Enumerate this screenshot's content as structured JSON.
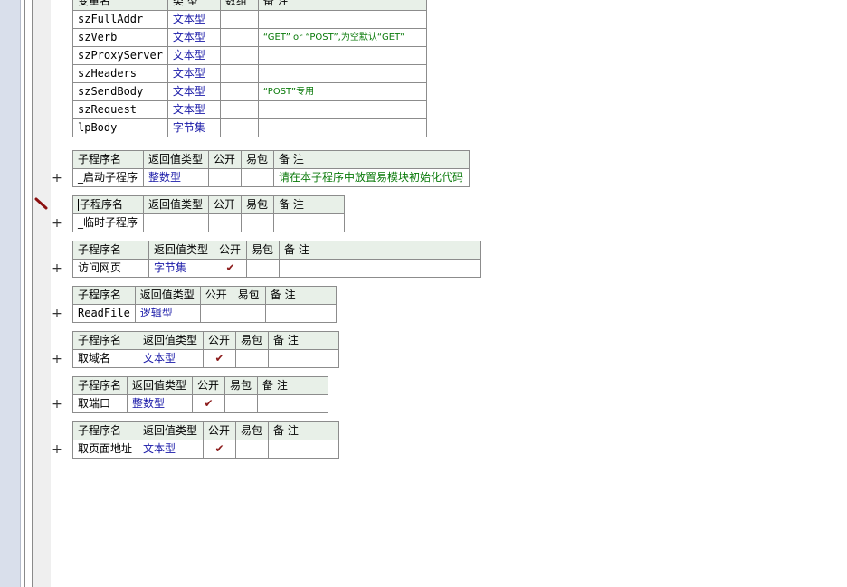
{
  "variables_table": {
    "headers": [
      "变量名",
      "类 型",
      "数组",
      "备 注"
    ],
    "rows": [
      {
        "name": "szFullAddr",
        "type": "文本型",
        "array": "",
        "remark": ""
      },
      {
        "name": "szVerb",
        "type": "文本型",
        "array": "",
        "remark": "“GET” or “POST”,为空默认“GET”"
      },
      {
        "name": "szProxyServer",
        "type": "文本型",
        "array": "",
        "remark": ""
      },
      {
        "name": "szHeaders",
        "type": "文本型",
        "array": "",
        "remark": ""
      },
      {
        "name": "szSendBody",
        "type": "文本型",
        "array": "",
        "remark": "“POST”专用"
      },
      {
        "name": "szRequest",
        "type": "文本型",
        "array": "",
        "remark": ""
      },
      {
        "name": "lpBody",
        "type": "字节集",
        "array": "",
        "remark": ""
      }
    ]
  },
  "sub_headers": {
    "name": "子程序名",
    "return_type": "返回值类型",
    "public": "公开",
    "easy": "易包",
    "remark": "备 注"
  },
  "subroutines": [
    {
      "name": "_启动子程序",
      "return_type": "整数型",
      "public": "",
      "easy": "",
      "remark": "请在本子程序中放置易模块初始化代码"
    },
    {
      "name": "_临时子程序",
      "return_type": "",
      "public": "",
      "easy": "",
      "remark": ""
    },
    {
      "name": "访问网页",
      "return_type": "字节集",
      "public": "✔",
      "easy": "",
      "remark": ""
    },
    {
      "name": "ReadFile",
      "return_type": "逻辑型",
      "public": "",
      "easy": "",
      "remark": ""
    },
    {
      "name": "取域名",
      "return_type": "文本型",
      "public": "✔",
      "easy": "",
      "remark": ""
    },
    {
      "name": "取端口",
      "return_type": "整数型",
      "public": "✔",
      "easy": "",
      "remark": ""
    },
    {
      "name": "取页面地址",
      "return_type": "文本型",
      "public": "✔",
      "easy": "",
      "remark": ""
    }
  ],
  "expand_glyph": "+",
  "icons": {
    "breakpoint_marker": "pencil-marker-icon",
    "expand": "plus-icon"
  },
  "colors": {
    "header_bg": "#e8f0e8",
    "type_text": "#1a1aa8",
    "remark_text": "#0a7a0a",
    "check": "#8b1a1a",
    "gutter": "#d9dfeb"
  }
}
